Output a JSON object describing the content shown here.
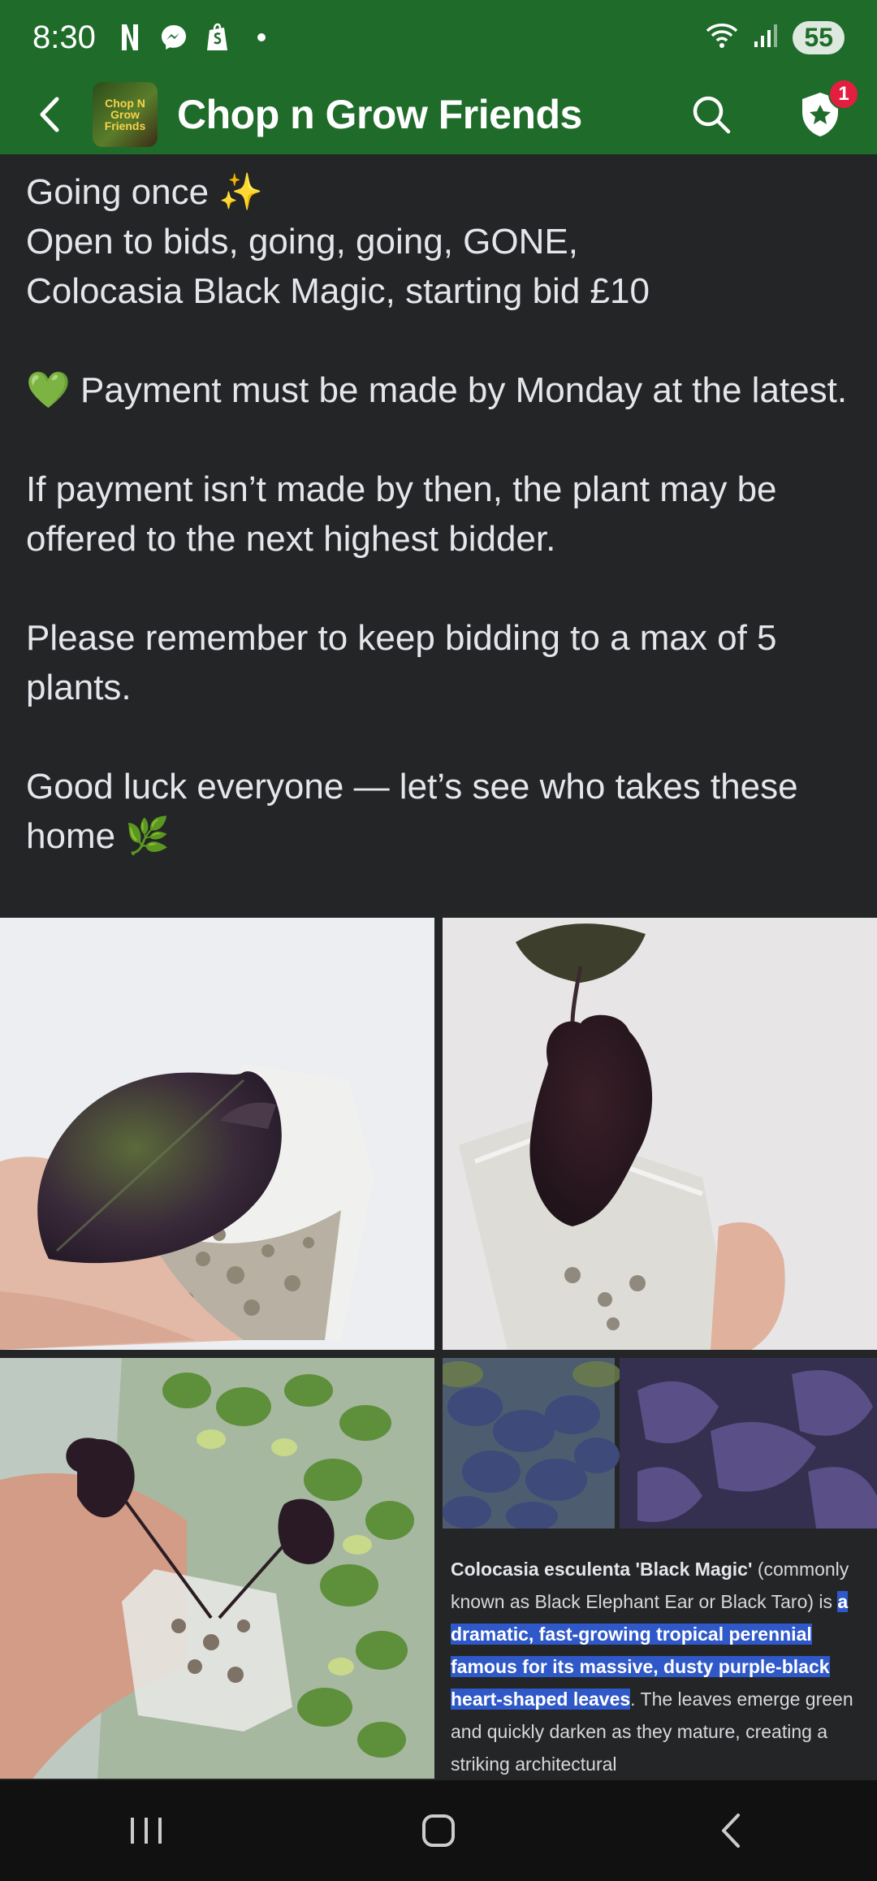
{
  "status_bar": {
    "time": "8:30",
    "battery": "55",
    "left_icons": [
      "netflix-icon",
      "messenger-icon",
      "shopify-icon",
      "dot-icon"
    ],
    "right_icons": [
      "wifi-icon",
      "signal-icon",
      "battery-icon"
    ]
  },
  "app_bar": {
    "title": "Chop n Grow Friends",
    "avatar_text": "Chop N Grow Friends",
    "notification_count": "1",
    "colors": {
      "bar": "#1f6b2a",
      "badge": "#e41e3f"
    }
  },
  "post": {
    "lines": [
      "Going once ✨",
      "Open to bids, going, going, GONE,",
      "Colocasia Black Magic, starting bid £10",
      "💚 Payment must be made by Monday at the latest.",
      "If payment isn’t made by then, the plant may be offered to the next highest bidder.",
      "Please remember to keep bidding to a max of 5 plants.",
      "Good luck everyone — let’s see who takes these home 🌿"
    ]
  },
  "info_card": {
    "name": "Colocasia esculenta 'Black Magic'",
    "text_before": " (commonly known as Black Elephant Ear or Black Taro) is ",
    "highlight": "a dramatic, fast-growing tropical perennial famous for its massive, dusty purple-black heart-shaped leaves",
    "text_after": ". The leaves emerge green and quickly darken as they mature, creating a striking architectural",
    "highlight_color": "#2f58c8"
  },
  "photos": [
    "plant-photo-1",
    "plant-photo-2",
    "plant-photo-3",
    "plant-info-screenshot"
  ],
  "nav": [
    "recent-apps",
    "home",
    "back"
  ]
}
